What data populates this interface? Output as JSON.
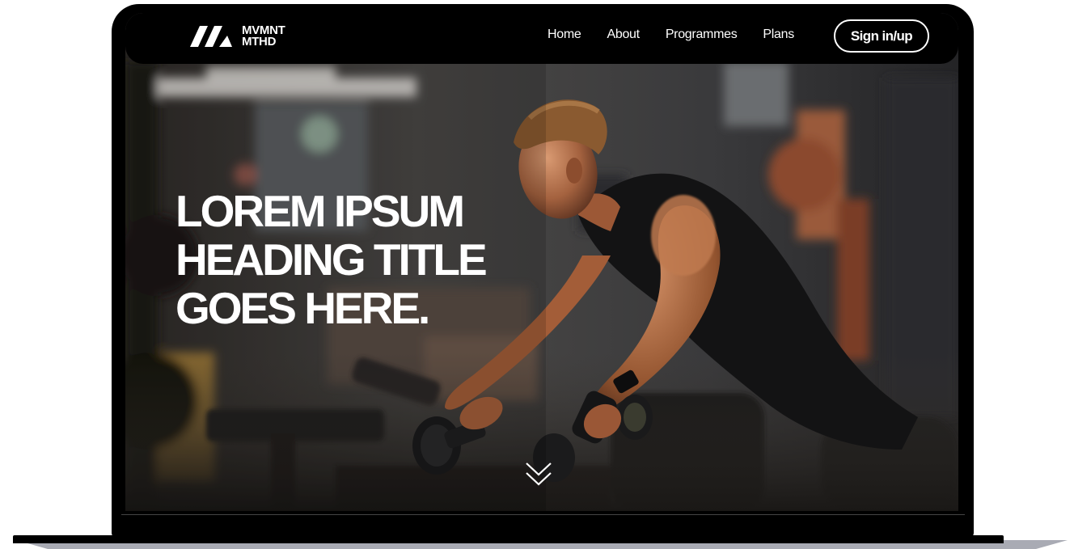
{
  "brand": {
    "name_line1": "MVMNT",
    "name_line2": "MTHD",
    "logo_icon": "mvmnt-mountain-logo"
  },
  "nav": {
    "links": [
      "Home",
      "About",
      "Programmes",
      "Plans"
    ],
    "signin_label": "Sign in/up"
  },
  "hero": {
    "heading_lines": [
      "LOREM IPSUM",
      "HEADING TITLE",
      "GOES HERE."
    ],
    "scroll_icon": "double-chevron-down-icon"
  },
  "colors": {
    "navbar_bg": "#000000",
    "text": "#ffffff",
    "device_frame": "#000000"
  }
}
